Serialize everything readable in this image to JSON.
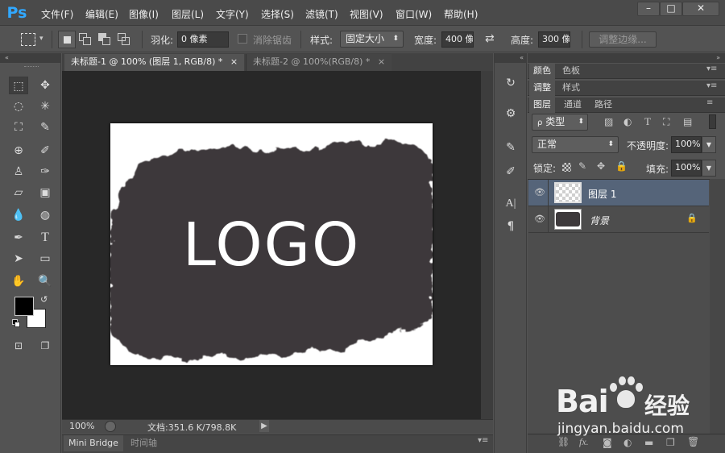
{
  "app": {
    "logo": "Ps"
  },
  "menu": [
    "文件(F)",
    "编辑(E)",
    "图像(I)",
    "图层(L)",
    "文字(Y)",
    "选择(S)",
    "滤镜(T)",
    "视图(V)",
    "窗口(W)",
    "帮助(H)"
  ],
  "window_controls": {
    "minimize": "–",
    "maximize": "□",
    "close": "✕"
  },
  "options": {
    "feather_label": "羽化:",
    "feather_value": "0 像素",
    "antialias_label": "消除锯齿",
    "style_label": "样式:",
    "style_value": "固定大小",
    "width_label": "宽度:",
    "width_value": "400 像",
    "height_label": "高度:",
    "height_value": "300 像",
    "refine_edge": "调整边缘..."
  },
  "documents": [
    {
      "title": "未标题-1 @ 100% (图层 1, RGB/8) *",
      "close": "×"
    },
    {
      "title": "未标题-2 @ 100%(RGB/8) *",
      "close": "×"
    }
  ],
  "artwork": {
    "text": "LOGO",
    "fill": "#3d393b"
  },
  "status": {
    "zoom": "100%",
    "doc": "文档:351.6 K/798.8K"
  },
  "bottom_tabs": [
    "Mini Bridge",
    "时间轴"
  ],
  "panels": {
    "group1": [
      "颜色",
      "色板"
    ],
    "group2": [
      "调整",
      "样式"
    ],
    "group3": [
      "图层",
      "通道",
      "路径"
    ],
    "filter_kind": "类型",
    "blend_mode": "正常",
    "opacity_label": "不透明度:",
    "opacity_value": "100%",
    "lock_label": "锁定:",
    "fill_label": "填充:",
    "fill_value": "100%",
    "layers": [
      {
        "name": "图层 1",
        "selected": true
      },
      {
        "name": "背景",
        "locked": true
      }
    ]
  },
  "watermark": {
    "brand": "Bai",
    "brand2": "经验",
    "url": "jingyan.baidu.com"
  },
  "colors": {
    "accent": "#31a8ff",
    "selected_layer": "#556479"
  }
}
